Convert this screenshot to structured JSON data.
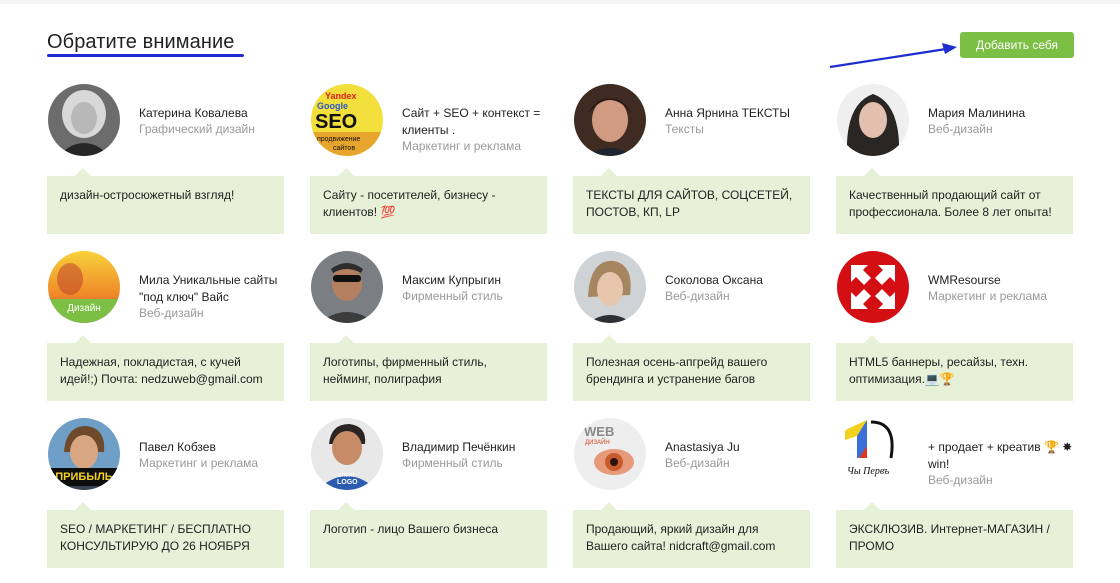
{
  "section": {
    "title": "Обратите внимание",
    "add_label": "Добавить себя"
  },
  "colors": {
    "accent_green": "#7cbf45",
    "bubble_bg": "#e6f1d8",
    "underline_blue": "#1d2dd0"
  },
  "cards": [
    {
      "name": "Катерина Ковалева",
      "category": "Графический дизайн",
      "text": "дизайн-остросюжетный взгляд!",
      "avatar": "portrait-blonde-woman"
    },
    {
      "name": "Сайт + SEO + контекст = клиенты .",
      "category": "Маркетинг и реклама",
      "text": "Сайту - посетителей, бизнесу - клиентов! 💯",
      "avatar": "seo-logo",
      "avatar_text": {
        "a": "Yandex",
        "b": "Google",
        "c": "SEO",
        "d": "продвижение",
        "e": "сайтов"
      }
    },
    {
      "name": "Анна Ярнина ТЕКСТЫ",
      "category": "Тексты",
      "text": "ТЕКСТЫ ДЛЯ САЙТОВ, СОЦСЕТЕЙ, ПОСТОВ, КП, LP",
      "avatar": "portrait-brunette-woman"
    },
    {
      "name": "Мария Малинина",
      "category": "Веб-дизайн",
      "text": "Качественный продающий сайт от профессионала. Более 8 лет опыта!",
      "avatar": "portrait-dark-hair-woman"
    },
    {
      "name": "Мила Уникальные сайты \"под ключ\" Вайс",
      "category": "Веб-дизайн",
      "text": "Надежная, покладистая, с кучей идей!;) Почта: nedzuweb@gmail.com",
      "avatar": "sunset-portrait",
      "badge": "Дизайн"
    },
    {
      "name": "Максим Купрыгин",
      "category": "Фирменный стиль",
      "text": "Логотипы, фирменный стиль, нейминг, полиграфия",
      "avatar": "portrait-man-sunglasses"
    },
    {
      "name": "Соколова Оксана",
      "category": "Веб-дизайн",
      "text": "Полезная осень-апгрейд вашего брендинга и устранение багов",
      "avatar": "portrait-woman-light"
    },
    {
      "name": "WMResourse",
      "category": "Маркетинг и реклама",
      "text": "HTML5 баннеры, ресайзы, техн. оптимизация.💻🏆",
      "avatar": "wmresourse-logo"
    },
    {
      "name": "Павел Кобзев",
      "category": "Маркетинг и реклама",
      "text": "SEO / МАРКЕТИНГ / БЕСПЛАТНО КОНСУЛЬТИРУЮ ДО 26 НОЯБРЯ",
      "avatar": "portrait-young-man",
      "ribbon": "ПРИБЫЛЬ"
    },
    {
      "name": "Владимир Печёнкин",
      "category": "Фирменный стиль",
      "text": "Логотип - лицо Вашего бизнеса",
      "avatar": "portrait-man-logo-shirt",
      "avatar_text": {
        "a": "GREAT",
        "b": "LOGO"
      }
    },
    {
      "name": "Anastasiya Ju",
      "category": "Веб-дизайн",
      "text": "Продающий, яркий дизайн для Вашего сайта! nidcraft@gmail.com",
      "avatar": "web-design-eye",
      "avatar_text": {
        "a": "WEB",
        "b": "ДИЗАЙН"
      }
    },
    {
      "name": "+ продает + креатив 🏆 ✸ win!",
      "category": "Веб-дизайн",
      "text": "ЭКСКЛЮЗИВ. Интернет-МАГАЗИН / ПРОМО",
      "avatar": "number-one-logo",
      "avatar_text": {
        "a": "Чы Первъ"
      }
    }
  ]
}
